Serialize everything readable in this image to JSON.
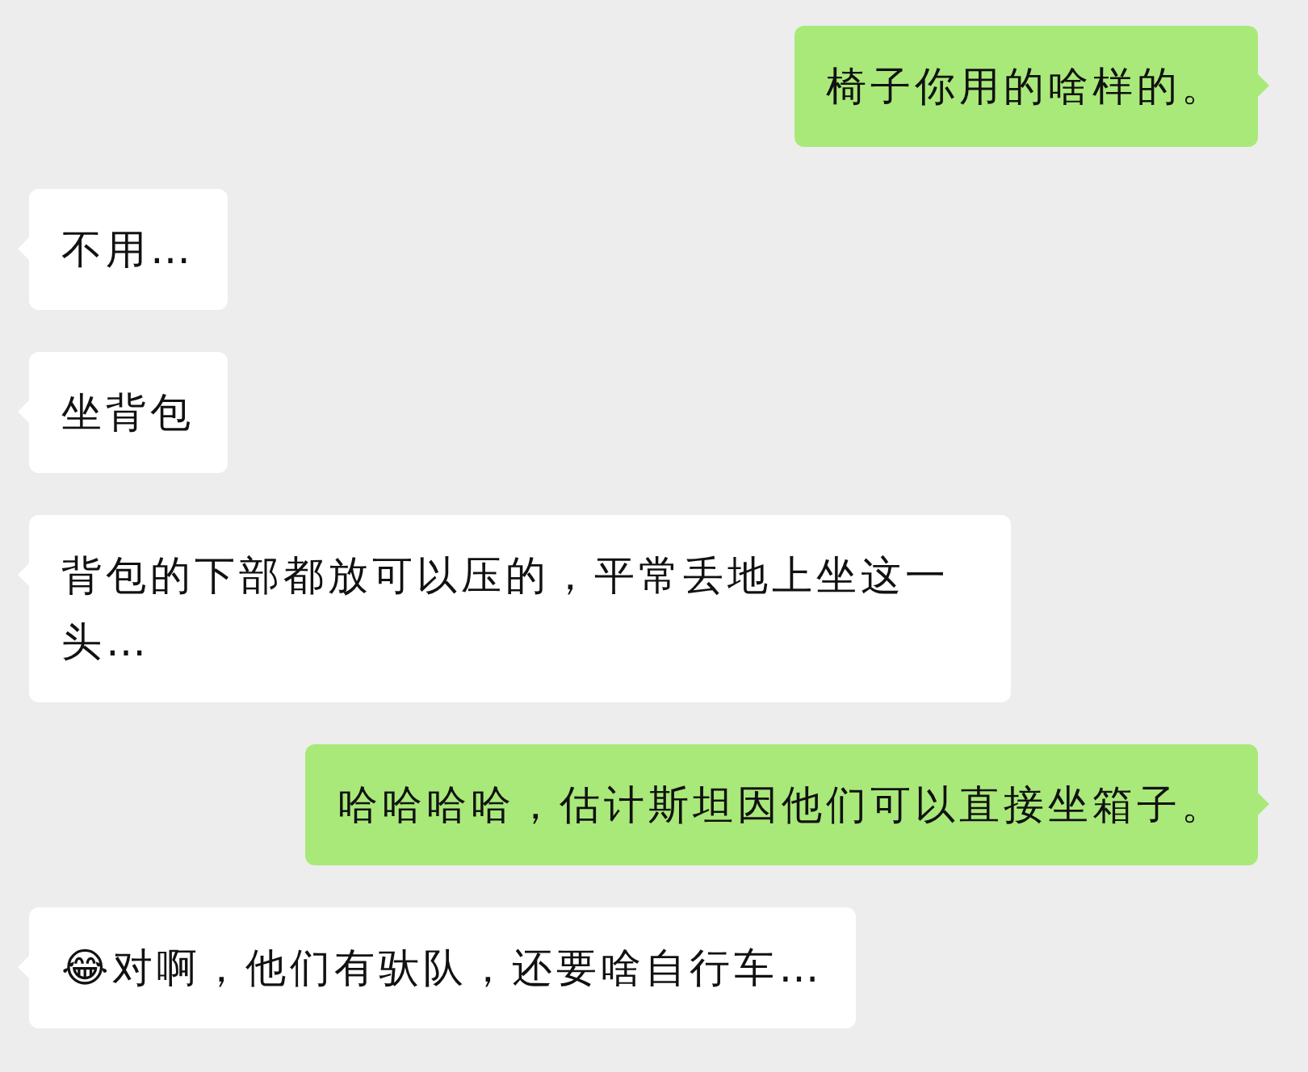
{
  "messages": [
    {
      "kind": "sent",
      "text": "椅子你用的啥样的。"
    },
    {
      "kind": "received",
      "text": "不用…"
    },
    {
      "kind": "received",
      "text": "坐背包"
    },
    {
      "kind": "received",
      "text": "背包的下部都放可以压的，平常丢地上坐这一头…"
    },
    {
      "kind": "sent",
      "text": "哈哈哈哈，估计斯坦因他们可以直接坐箱子。"
    },
    {
      "kind": "received",
      "text": "😂对啊，他们有驮队，还要啥自行车…"
    }
  ]
}
